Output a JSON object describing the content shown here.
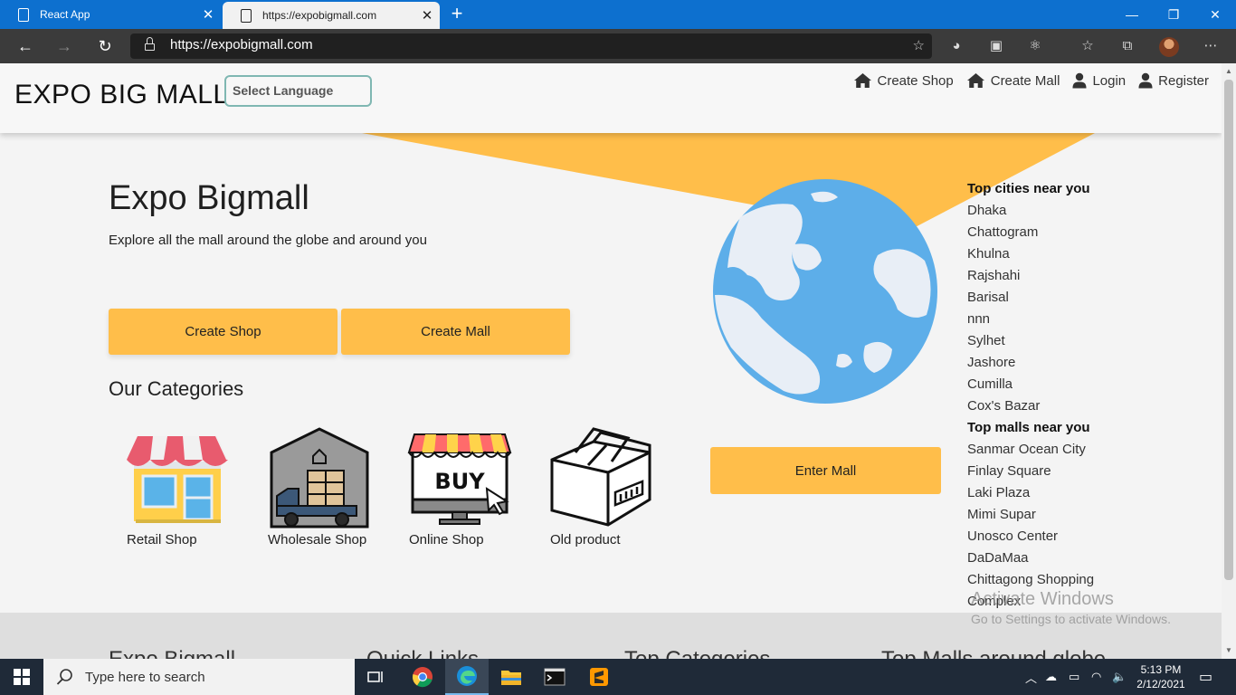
{
  "browser": {
    "tabs": [
      {
        "label": "React App",
        "active": false
      },
      {
        "label": "https://expobigmall.com",
        "active": true
      }
    ],
    "url": "https://expobigmall.com"
  },
  "header": {
    "logo": "EXPO BIG MALL",
    "language_select": "Select Language",
    "nav": {
      "create_shop": "Create Shop",
      "create_mall": "Create Mall",
      "login": "Login",
      "register": "Register"
    }
  },
  "hero": {
    "title": "Expo Bigmall",
    "subtitle": "Explore all the mall around the globe and around you",
    "create_shop_button": "Create Shop",
    "create_mall_button": "Create Mall",
    "enter_mall_button": "Enter Mall"
  },
  "categories": {
    "title": "Our Categories",
    "items": [
      {
        "label": "Retail Shop",
        "icon": "retail-shop-icon"
      },
      {
        "label": "Wholesale Shop",
        "icon": "wholesale-warehouse-icon"
      },
      {
        "label": "Online Shop",
        "icon": "online-shop-buy-icon"
      },
      {
        "label": "Old product",
        "icon": "old-product-box-icon"
      }
    ]
  },
  "top_cities": {
    "heading": "Top cities near you",
    "items": [
      "Dhaka",
      "Chattogram",
      "Khulna",
      "Rajshahi",
      "Barisal",
      "nnn",
      "Sylhet",
      "Jashore",
      "Cumilla",
      "Cox's Bazar"
    ]
  },
  "top_malls": {
    "heading": "Top malls near you",
    "items": [
      "Sanmar Ocean City",
      "Finlay Square",
      "Laki Plaza",
      "Mimi Supar",
      "Unosco Center",
      "DaDaMaa",
      "Chittagong Shopping Complex"
    ]
  },
  "footer": {
    "columns": [
      "Expo Bigmall",
      "Quick Links",
      "Top Categories",
      "Top Malls around globe"
    ]
  },
  "watermark": {
    "line1": "Activate Windows",
    "line2": "Go to Settings to activate Windows."
  },
  "taskbar": {
    "search_placeholder": "Type here to search",
    "time": "5:13 PM",
    "date": "2/12/2021"
  },
  "colors": {
    "accent": "#ffbe4a",
    "titlebar": "#0d70cf",
    "globe_water": "#5daee9",
    "globe_land": "#e8eef6"
  }
}
